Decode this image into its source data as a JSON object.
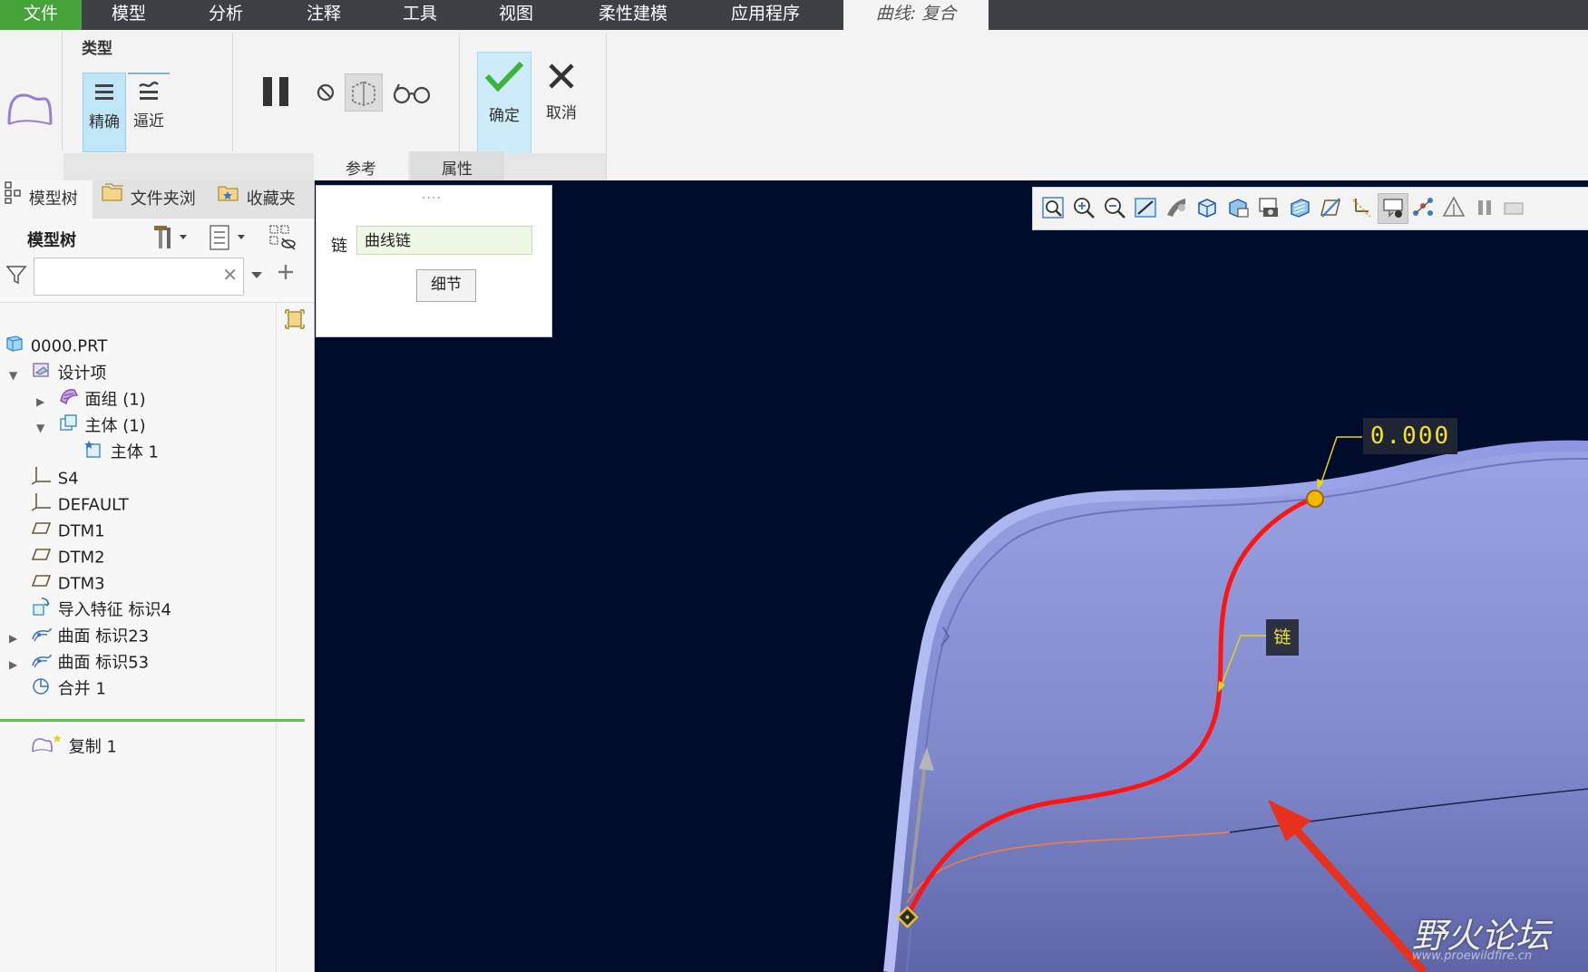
{
  "menu": {
    "items": [
      "文件",
      "模型",
      "分析",
      "注释",
      "工具",
      "视图",
      "柔性建模",
      "应用程序"
    ],
    "active_tab": "曲线: 复合"
  },
  "ribbon": {
    "type_group_label": "类型",
    "exact_label": "精确",
    "approx_label": "逼近",
    "ok_label": "确定",
    "cancel_label": "取消",
    "tab_references": "参考",
    "tab_properties": "属性"
  },
  "ref_panel": {
    "chain_label": "链",
    "chain_value": "曲线链",
    "details_button": "细节"
  },
  "left_panel": {
    "tabs": [
      "模型树",
      "文件夹浏",
      "收藏夹"
    ],
    "title": "模型树",
    "search_placeholder": "",
    "tree": [
      {
        "label": "0000.PRT",
        "icon": "part-icon"
      },
      {
        "label": "设计项",
        "icon": "design-items-icon"
      },
      {
        "label": "面组 (1)",
        "icon": "quilt-icon"
      },
      {
        "label": "主体 (1)",
        "icon": "body-icon"
      },
      {
        "label": "主体 1",
        "icon": "body-item-icon"
      },
      {
        "label": "S4",
        "icon": "csys-icon"
      },
      {
        "label": "DEFAULT",
        "icon": "csys-icon"
      },
      {
        "label": "DTM1",
        "icon": "datum-plane-icon"
      },
      {
        "label": "DTM2",
        "icon": "datum-plane-icon"
      },
      {
        "label": "DTM3",
        "icon": "datum-plane-icon"
      },
      {
        "label": "导入特征 标识4",
        "icon": "import-icon"
      },
      {
        "label": "曲面 标识23",
        "icon": "surface-icon"
      },
      {
        "label": "曲面 标识53",
        "icon": "surface-icon"
      },
      {
        "label": "合并 1",
        "icon": "merge-icon"
      },
      {
        "label": "复制 1",
        "icon": "copy-curve-icon"
      }
    ]
  },
  "viewport": {
    "dimension_value": "0.000",
    "chain_tag": "链"
  },
  "watermark": {
    "text": "野火论坛",
    "sub": "www.proewildfire.cn"
  },
  "colors": {
    "menu_bg": "#3d4144",
    "file_tab": "#44a339",
    "viewport_bg": "#000c2b",
    "surface": "#8c95d8",
    "chain_curve": "#ff1414",
    "accent_green": "#3cb43c"
  }
}
